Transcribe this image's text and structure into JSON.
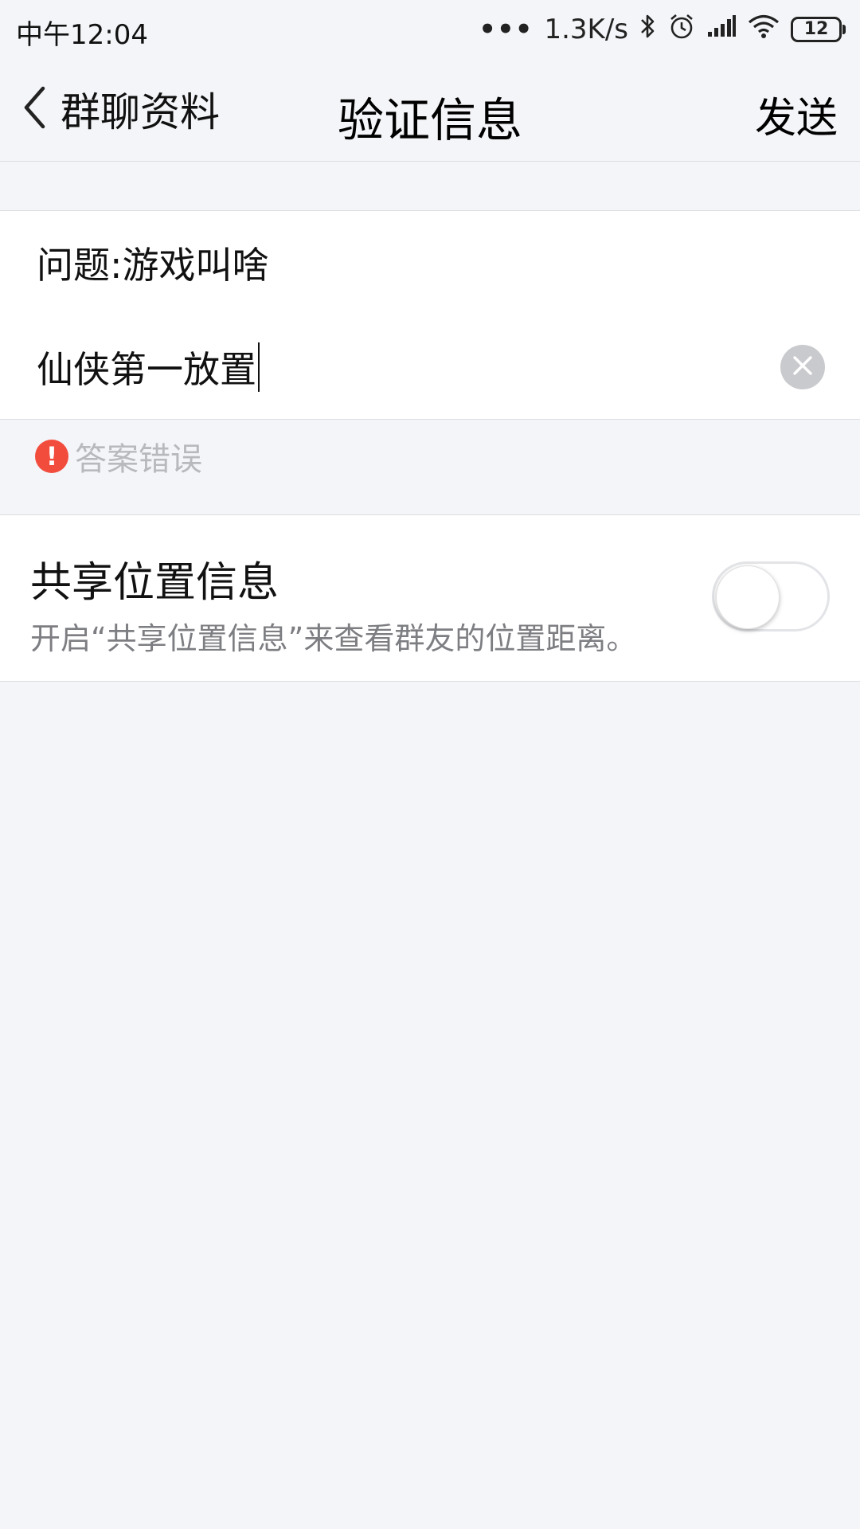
{
  "status_bar": {
    "time": "中午12:04",
    "dots": "•••",
    "net_speed": "1.3K/s",
    "battery": "12",
    "icons": [
      "bluetooth-icon",
      "alarm-icon",
      "signal-icon",
      "wifi-icon",
      "battery-icon"
    ]
  },
  "nav": {
    "back_label": "群聊资料",
    "title": "验证信息",
    "send_label": "发送"
  },
  "form": {
    "question": "问题:游戏叫啥",
    "answer_value": "仙侠第一放置",
    "error_icon": "!",
    "error_text": "答案错误"
  },
  "location": {
    "title": "共享位置信息",
    "description": "开启“共享位置信息”来查看群友的位置距离。",
    "enabled": false
  },
  "colors": {
    "background": "#f4f5f8",
    "error": "#f24c3d",
    "hint": "#b8b9bd",
    "secondary_text": "#7d7e82"
  }
}
